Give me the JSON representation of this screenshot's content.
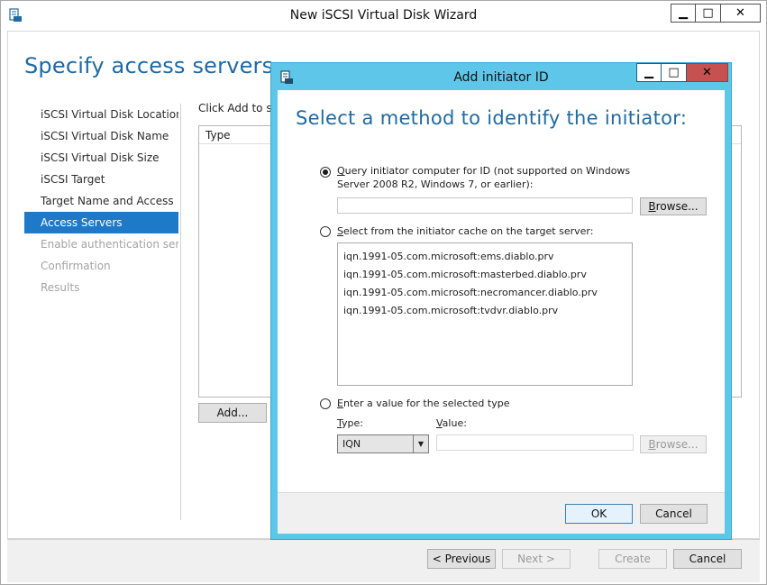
{
  "wizard": {
    "title": "New iSCSI Virtual Disk Wizard",
    "page_title": "Specify access servers",
    "steps": [
      {
        "label": "iSCSI Virtual Disk Location",
        "state": "normal"
      },
      {
        "label": "iSCSI Virtual Disk Name",
        "state": "normal"
      },
      {
        "label": "iSCSI Virtual Disk Size",
        "state": "normal"
      },
      {
        "label": "iSCSI Target",
        "state": "normal"
      },
      {
        "label": "Target Name and Access",
        "state": "normal"
      },
      {
        "label": "Access Servers",
        "state": "active"
      },
      {
        "label": "Enable authentication ser...",
        "state": "disabled"
      },
      {
        "label": "Confirmation",
        "state": "disabled"
      },
      {
        "label": "Results",
        "state": "disabled"
      }
    ],
    "instruction": "Click Add to sp",
    "list_column": "Type",
    "add_button": "Add...",
    "footer": {
      "previous": "< Previous",
      "next": "Next >",
      "create": "Create",
      "cancel": "Cancel"
    }
  },
  "dialog": {
    "title": "Add initiator ID",
    "heading": "Select a method to identify the initiator:",
    "option_query": {
      "accel": "Q",
      "line1_rest": "uery initiator computer for ID (not supported on Windows",
      "line2": "Server 2008 R2, Windows 7, or earlier):",
      "selected": true,
      "input_value": ""
    },
    "browse_label_accel": "B",
    "browse_label_rest": "rowse...",
    "option_cache": {
      "accel": "S",
      "rest": "elect from the initiator cache on the target server:",
      "selected": false
    },
    "cache_items": [
      "iqn.1991-05.com.microsoft:ems.diablo.prv",
      "iqn.1991-05.com.microsoft:masterbed.diablo.prv",
      "iqn.1991-05.com.microsoft:necromancer.diablo.prv",
      "iqn.1991-05.com.microsoft:tvdvr.diablo.prv"
    ],
    "option_value": {
      "accel": "E",
      "rest": "nter a value for the selected type",
      "selected": false
    },
    "type_label_accel": "T",
    "type_label_rest": "ype:",
    "value_label_accel": "V",
    "value_label_rest": "alue:",
    "type_selected": "IQN",
    "value_input": "",
    "browse2_label_accel": "B",
    "browse2_label_rest": "rowse...",
    "ok": "OK",
    "cancel": "Cancel"
  },
  "colors": {
    "accent_blue": "#1e6aa5",
    "active_step": "#1e79c8",
    "dialog_frame": "#5ec6e8",
    "close_red": "#c75050"
  }
}
